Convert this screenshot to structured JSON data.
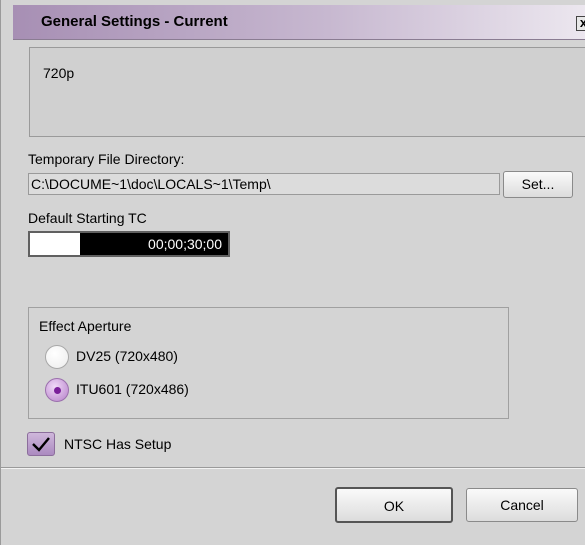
{
  "window": {
    "title": "General Settings - Current",
    "close_label": "x"
  },
  "info": {
    "format_text": "720p"
  },
  "temp_dir": {
    "label": "Temporary File Directory:",
    "path": "C:\\DOCUME~1\\doc\\LOCALS~1\\Temp\\",
    "set_button": "Set..."
  },
  "start_tc": {
    "label": "Default Starting TC",
    "value": "00;00;30;00"
  },
  "aperture": {
    "label": "Effect Aperture",
    "options": [
      {
        "label": "DV25 (720x480)",
        "selected": false
      },
      {
        "label": "ITU601 (720x486)",
        "selected": true
      }
    ]
  },
  "ntsc_setup": {
    "label": "NTSC Has Setup",
    "checked": true
  },
  "footer": {
    "ok_label": "OK",
    "cancel_label": "Cancel"
  },
  "colors": {
    "title_gradient_start": "#a78fb4",
    "accent_purple": "#7a1f9a",
    "background": "#d4d4d4"
  }
}
